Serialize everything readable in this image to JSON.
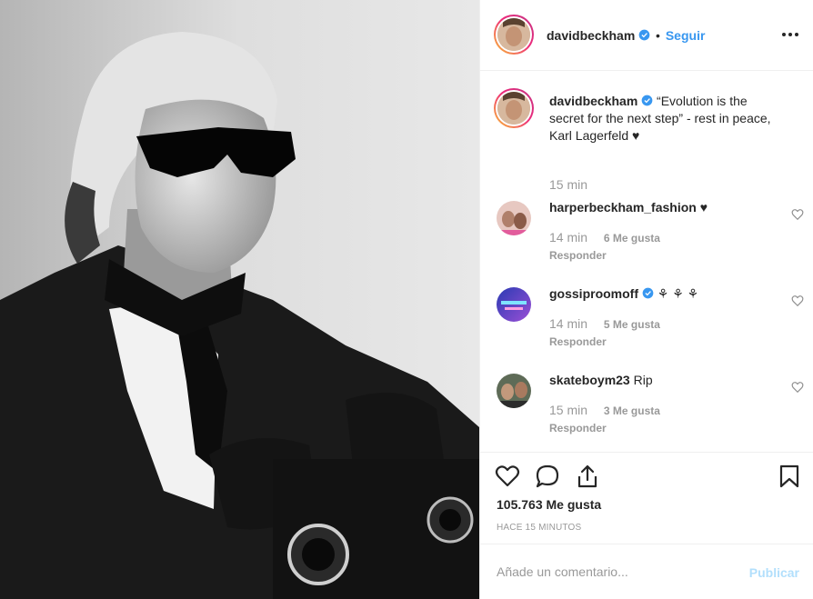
{
  "post": {
    "author": "davidbeckham",
    "follow_label": "Seguir",
    "dot": "•",
    "verified": true,
    "photo_icon": "portrait-photo"
  },
  "caption": {
    "author": "davidbeckham",
    "text": "“Evolution is the secret for the next step” - rest in peace, Karl Lagerfeld ♥",
    "time": "15 min"
  },
  "comments": [
    {
      "user": "harperbeckham_fashion",
      "text": "♥",
      "verified": false,
      "time": "14 min",
      "likes": "6 Me gusta",
      "reply": "Responder"
    },
    {
      "user": "gossiproomoff",
      "text": "⚘ ⚘ ⚘",
      "verified": true,
      "time": "14 min",
      "likes": "5 Me gusta",
      "reply": "Responder"
    },
    {
      "user": "skateboym23",
      "text": "Rip",
      "verified": false,
      "time": "15 min",
      "likes": "3 Me gusta",
      "reply": "Responder"
    }
  ],
  "stats": {
    "likes": "105.763 Me gusta",
    "time_ago": "HACE 15 MINUTOS"
  },
  "composer": {
    "placeholder": "Añade un comentario...",
    "publish_label": "Publicar"
  },
  "colors": {
    "link": "#3897f0",
    "muted": "#999999",
    "publish_disabled": "#b2dffc",
    "border": "#efefef"
  },
  "icons": [
    "more-options-icon",
    "heart-icon",
    "comment-icon",
    "share-icon",
    "bookmark-icon",
    "verified-badge-icon"
  ]
}
